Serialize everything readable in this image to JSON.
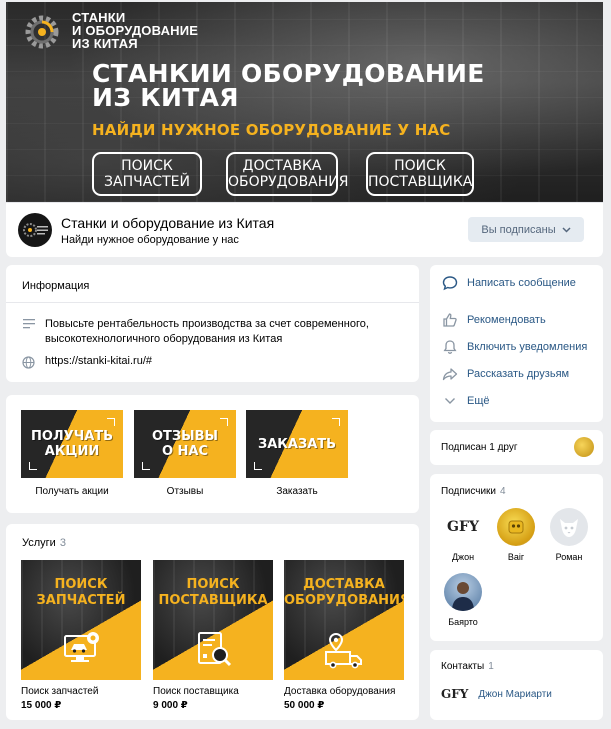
{
  "cover": {
    "logo_line1": "СТАНКИ",
    "logo_line2": "И ОБОРУДОВАНИЕ",
    "logo_line3": "ИЗ КИТАЯ",
    "title_line1": "СТАНКИИ ОБОРУДОВАНИЕ",
    "title_line2": "ИЗ КИТАЯ",
    "subtitle": "НАЙДИ НУЖНОЕ ОБОРУДОВАНИЕ У НАС",
    "buttons": [
      {
        "line1": "ПОИСК",
        "line2": "ЗАПЧАСТЕЙ"
      },
      {
        "line1": "ДОСТАВКА",
        "line2": "ОБОРУДОВАНИЯ"
      },
      {
        "line1": "ПОИСК",
        "line2": "ПОСТАВЩИКА"
      }
    ]
  },
  "group": {
    "name": "Станки и оборудование из Китая",
    "status": "Найди нужное оборудование у нас",
    "subscribe_label": "Вы подписаны"
  },
  "info": {
    "title": "Информация",
    "description_line1": "Повысьте рентабельность производства за счет современного,",
    "description_line2": "высокотехнологичного оборудования из Китая",
    "link": "https://stanki-kitai.ru/#"
  },
  "actions": {
    "message": "Написать сообщение",
    "recommend": "Рекомендовать",
    "notifications": "Включить уведомления",
    "share": "Рассказать друзьям",
    "more": "Ещё"
  },
  "promo": [
    {
      "line1": "ПОЛУЧАТЬ",
      "line2": "АКЦИИ",
      "label": "Получать акции"
    },
    {
      "line1": "ОТЗЫВЫ",
      "line2": "О НАС",
      "label": "Отзывы"
    },
    {
      "line1": "ЗАКАЗАТЬ",
      "line2": "",
      "label": "Заказать"
    }
  ],
  "services": {
    "title": "Услуги",
    "count": "3",
    "items": [
      {
        "line1": "ПОИСК",
        "line2": "ЗАПЧАСТЕЙ",
        "label": "Поиск запчастей",
        "price": "15 000 ₽",
        "icon": "computer-car-icon"
      },
      {
        "line1": "ПОИСК",
        "line2": "ПОСТАВЩИКА",
        "label": "Поиск поставщика",
        "price": "9 000 ₽",
        "icon": "document-search-icon"
      },
      {
        "line1": "ДОСТАВКА",
        "line2": "ОБОРУДОВАНИЯ",
        "label": "Доставка оборудования",
        "price": "50 000 ₽",
        "icon": "delivery-truck-icon"
      }
    ]
  },
  "friend": {
    "label": "Подписан 1 друг"
  },
  "subscribers": {
    "title": "Подписчики",
    "count": "4",
    "items": [
      {
        "name": "Джон",
        "avatar_text": "GFY"
      },
      {
        "name": "Baiг"
      },
      {
        "name": "Роман"
      },
      {
        "name": "Баярто"
      }
    ]
  },
  "contacts": {
    "title": "Контакты",
    "count": "1",
    "item_logo": "GFY",
    "item_name": "Джон Мариарти"
  },
  "colors": {
    "accent_yellow": "#f5b21f",
    "link_blue": "#2a5885",
    "page_bg": "#edeef0",
    "button_bg": "#e5ebf1"
  }
}
